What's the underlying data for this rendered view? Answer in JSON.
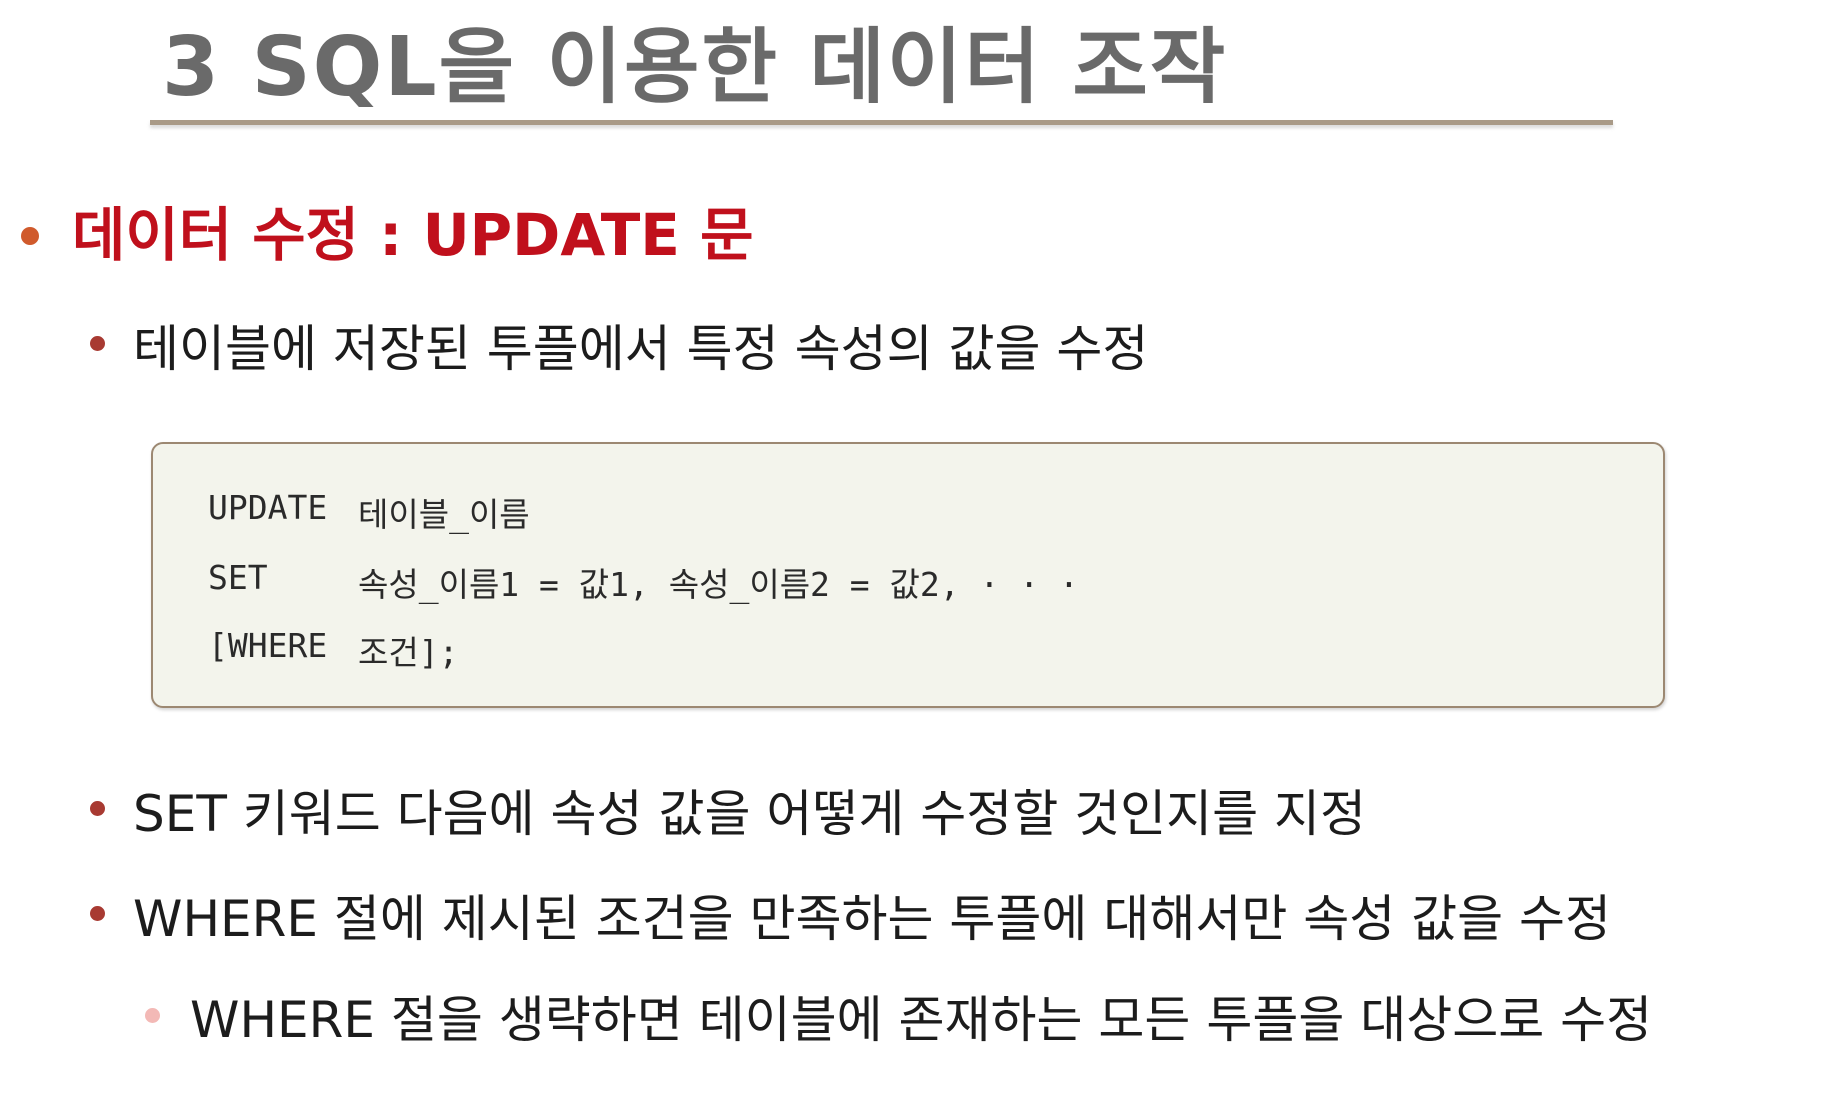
{
  "slide": {
    "title": "3 SQL을 이용한 데이터 조작"
  },
  "section": {
    "heading": "데이터 수정 : UPDATE 문",
    "points": [
      "테이블에 저장된 투플에서 특정 속성의 값을 수정",
      "SET 키워드 다음에 속성 값을 어떻게 수정할 것인지를 지정",
      "WHERE 절에 제시된 조건을 만족하는 투플에 대해서만 속성 값을 수정"
    ],
    "subpoint": "WHERE 절을 생략하면 테이블에 존재하는 모든 투플을 대상으로 수정"
  },
  "syntax": {
    "rows": [
      {
        "keyword": "UPDATE",
        "value": "테이블_이름"
      },
      {
        "keyword": "SET",
        "value": "속성_이름1 = 값1, 속성_이름2 = 값2, · · ·"
      },
      {
        "keyword": "[WHERE",
        "value": "조건];"
      }
    ]
  },
  "colors": {
    "heading": "#c0101c",
    "title": "#6a6a6a",
    "code_background": "#f3f4ec",
    "code_border": "#9c8872"
  }
}
